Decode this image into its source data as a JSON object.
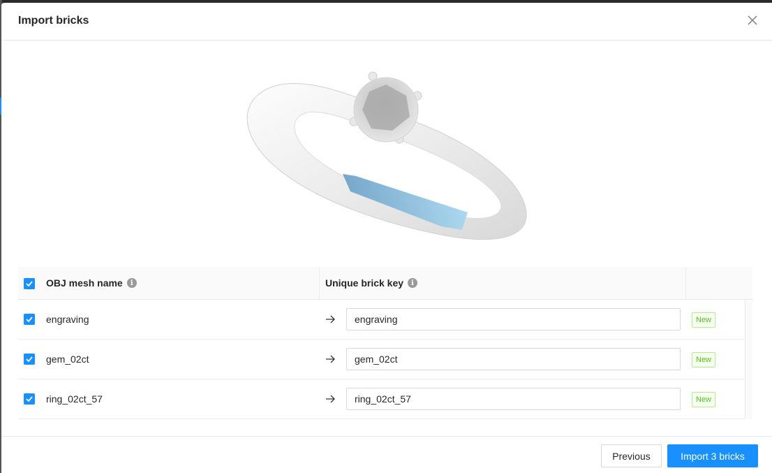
{
  "modal": {
    "title": "Import bricks",
    "close_icon": "close-icon"
  },
  "preview": {
    "description_icon": "ring-3d-preview",
    "highlight_color": "#8fc4e6"
  },
  "table": {
    "columns": {
      "mesh_name": "OBJ mesh name",
      "brick_key": "Unique brick key"
    },
    "rows": [
      {
        "mesh_name": "engraving",
        "brick_key": "engraving",
        "badge": "New",
        "checked": true
      },
      {
        "mesh_name": "gem_02ct",
        "brick_key": "gem_02ct",
        "badge": "New",
        "checked": true
      },
      {
        "mesh_name": "ring_02ct_57",
        "brick_key": "ring_02ct_57",
        "badge": "New",
        "checked": true
      }
    ]
  },
  "footer": {
    "previous_label": "Previous",
    "import_label": "Import 3 bricks"
  },
  "colors": {
    "primary": "#1890ff",
    "badge_green": "#52c41a"
  }
}
